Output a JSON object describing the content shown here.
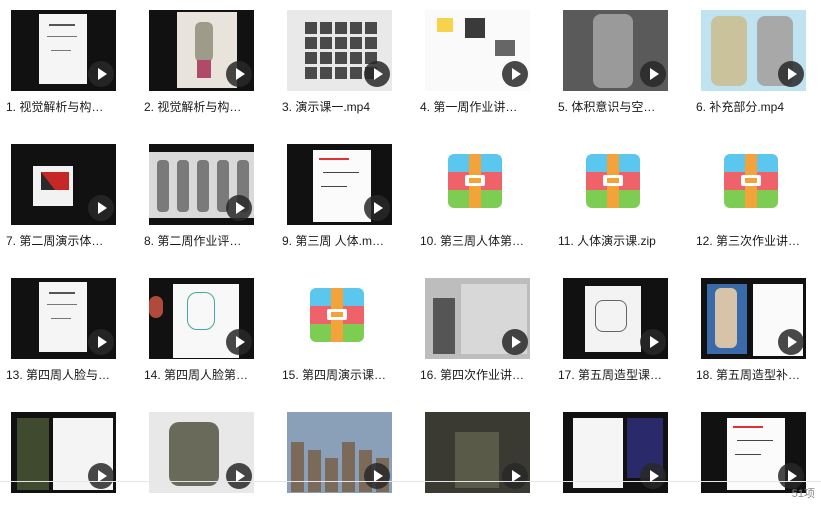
{
  "files": [
    {
      "label": "1. 视觉解析与构…",
      "type": "video",
      "icon": "play-icon"
    },
    {
      "label": "2. 视觉解析与构…",
      "type": "video",
      "icon": "play-icon"
    },
    {
      "label": "3. 演示课一.mp4",
      "type": "video",
      "icon": "play-icon"
    },
    {
      "label": "4. 第一周作业讲…",
      "type": "video",
      "icon": "play-icon"
    },
    {
      "label": "5. 体积意识与空…",
      "type": "video",
      "icon": "play-icon"
    },
    {
      "label": "6. 补充部分.mp4",
      "type": "video",
      "icon": "play-icon"
    },
    {
      "label": "7. 第二周演示体…",
      "type": "video",
      "icon": "play-icon"
    },
    {
      "label": "8. 第二周作业评…",
      "type": "video",
      "icon": "play-icon"
    },
    {
      "label": "9. 第三周 人体.m…",
      "type": "video",
      "icon": "play-icon"
    },
    {
      "label": "10. 第三周人体第…",
      "type": "zip",
      "icon": "archive-icon"
    },
    {
      "label": "11. 人体演示课.zip",
      "type": "zip",
      "icon": "archive-icon"
    },
    {
      "label": "12. 第三次作业讲…",
      "type": "zip",
      "icon": "archive-icon"
    },
    {
      "label": "13. 第四周人脸与…",
      "type": "video",
      "icon": "play-icon"
    },
    {
      "label": "14. 第四周人脸第…",
      "type": "video",
      "icon": "play-icon"
    },
    {
      "label": "15. 第四周演示课…",
      "type": "zip",
      "icon": "archive-icon"
    },
    {
      "label": "16. 第四次作业讲…",
      "type": "video",
      "icon": "play-icon"
    },
    {
      "label": "17. 第五周造型课…",
      "type": "video",
      "icon": "play-icon"
    },
    {
      "label": "18. 第五周造型补…",
      "type": "video",
      "icon": "play-icon"
    },
    {
      "label": "",
      "type": "video",
      "icon": "play-icon"
    },
    {
      "label": "",
      "type": "video",
      "icon": "play-icon"
    },
    {
      "label": "",
      "type": "video",
      "icon": "play-icon"
    },
    {
      "label": "",
      "type": "video",
      "icon": "play-icon"
    },
    {
      "label": "",
      "type": "video",
      "icon": "play-icon"
    },
    {
      "label": "",
      "type": "video",
      "icon": "play-icon"
    }
  ],
  "status": {
    "item_count": "51项"
  },
  "colors": {
    "zip_blue": "#5bc6ee",
    "zip_red": "#f0626a",
    "zip_green": "#7ccd52",
    "zip_orange": "#f4a23a"
  }
}
